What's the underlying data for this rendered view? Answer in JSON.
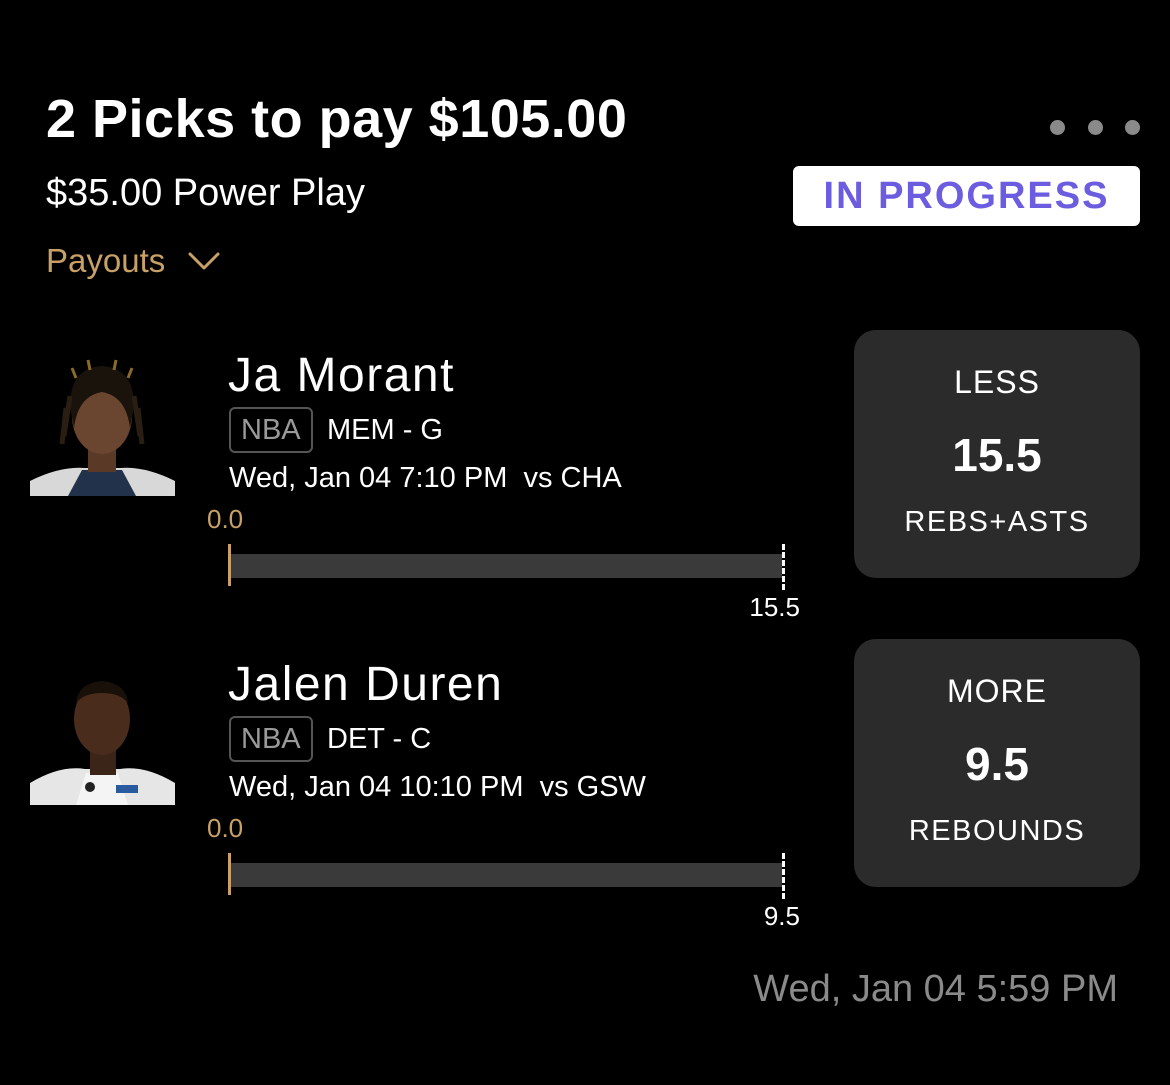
{
  "header": {
    "title": "2 Picks to pay $105.00",
    "subtitle": "$35.00 Power Play",
    "payouts_label": "Payouts",
    "status": "IN PROGRESS"
  },
  "colors": {
    "background": "#000000",
    "accent_gold": "#c9a066",
    "status_purple": "#6b5ce0",
    "card_bg": "#2b2b2b",
    "track_bg": "#3a3a3a"
  },
  "picks": [
    {
      "player": "Ja Morant",
      "league": "NBA",
      "team_pos": "MEM - G",
      "game_time": "Wed, Jan 04 7:10 PM  vs CHA",
      "progress_value": "0.0",
      "line_value": "15.5",
      "direction": "LESS",
      "line": "15.5",
      "stat": "REBS+ASTS"
    },
    {
      "player": "Jalen Duren",
      "league": "NBA",
      "team_pos": "DET - C",
      "game_time": "Wed, Jan 04 10:10 PM  vs GSW",
      "progress_value": "0.0",
      "line_value": "9.5",
      "direction": "MORE",
      "line": "9.5",
      "stat": "REBOUNDS"
    }
  ],
  "footer": {
    "timestamp": "Wed, Jan 04 5:59 PM"
  },
  "icons": {
    "menu": "more-horizontal-icon",
    "payouts": "chevron-down-icon"
  }
}
